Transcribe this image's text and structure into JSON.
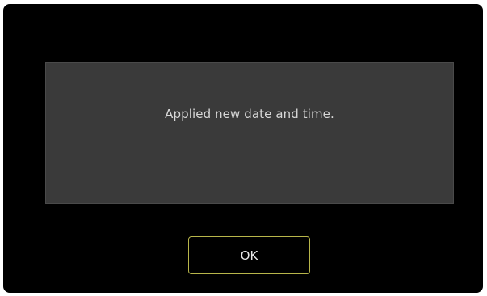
{
  "dialog": {
    "message": "Applied new date and time.",
    "ok_label": "OK"
  },
  "colors": {
    "dialog_background": "#000000",
    "panel_background": "#3a3a3a",
    "button_border_accent": "#b7b54a",
    "text": "#d8d8d8"
  }
}
